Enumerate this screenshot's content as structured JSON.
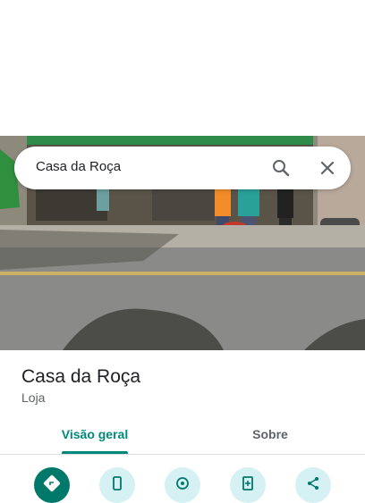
{
  "search": {
    "query": "Casa da Roça"
  },
  "place": {
    "name": "Casa da Roça",
    "category": "Loja"
  },
  "tabs": [
    {
      "label": "Visão geral",
      "active": true
    },
    {
      "label": "Sobre",
      "active": false
    }
  ],
  "actions": [
    {
      "icon": "directions-icon"
    },
    {
      "icon": "phone-icon"
    },
    {
      "icon": "save-location-icon"
    },
    {
      "icon": "add-photo-icon"
    },
    {
      "icon": "share-icon"
    }
  ],
  "colors": {
    "accent": "#00897b",
    "primary_button": "#00796b",
    "secondary_button": "#d6f1f3"
  }
}
